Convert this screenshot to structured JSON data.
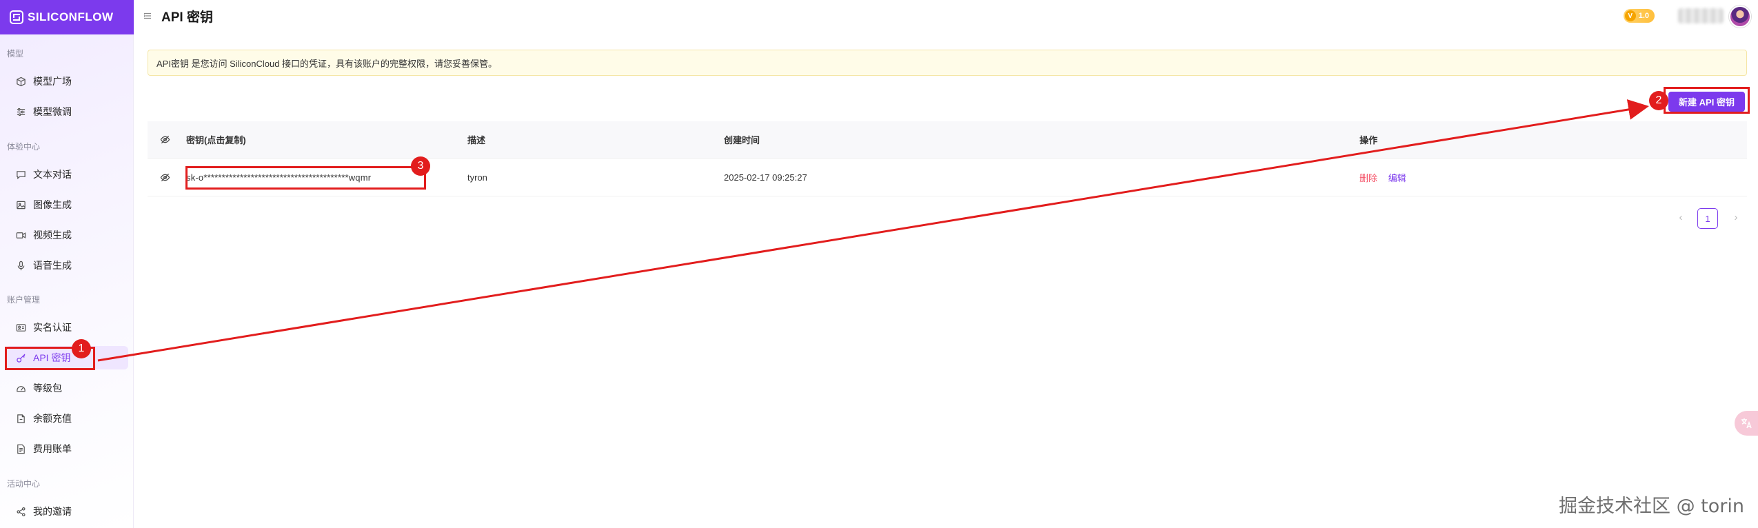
{
  "brand": {
    "name": "SILICONFLOW"
  },
  "sidebar": {
    "sections": [
      {
        "label": "模型",
        "items": [
          {
            "label": "模型广场",
            "icon": "cube-icon"
          },
          {
            "label": "模型微调",
            "icon": "sliders-icon"
          }
        ]
      },
      {
        "label": "体验中心",
        "items": [
          {
            "label": "文本对话",
            "icon": "chat-icon"
          },
          {
            "label": "图像生成",
            "icon": "image-icon"
          },
          {
            "label": "视频生成",
            "icon": "video-icon"
          },
          {
            "label": "语音生成",
            "icon": "mic-icon"
          }
        ]
      },
      {
        "label": "账户管理",
        "items": [
          {
            "label": "实名认证",
            "icon": "id-card-icon"
          },
          {
            "label": "API 密钥",
            "icon": "key-icon",
            "active": true
          },
          {
            "label": "等级包",
            "icon": "gauge-icon"
          },
          {
            "label": "余额充值",
            "icon": "wallet-icon"
          },
          {
            "label": "费用账单",
            "icon": "bill-icon"
          }
        ]
      },
      {
        "label": "活动中心",
        "items": [
          {
            "label": "我的邀请",
            "icon": "share-icon"
          }
        ]
      }
    ]
  },
  "header": {
    "title": "API 密钥",
    "level": "1.0"
  },
  "notice": "API密钥 是您访问 SiliconCloud 接口的凭证，具有该账户的完整权限，请您妥善保管。",
  "actions": {
    "new_key_label": "新建 API 密钥"
  },
  "table": {
    "columns": [
      "密钥(点击复制)",
      "描述",
      "创建时间",
      "操作"
    ],
    "rows": [
      {
        "key": "sk-o****************************************wqmr",
        "description": "tyron",
        "created": "2025-02-17 09:25:27",
        "ops": [
          "删除",
          "编辑"
        ]
      }
    ]
  },
  "pagination": {
    "current": "1",
    "prev": "‹",
    "next": "›"
  },
  "annotations": {
    "badges": [
      "1",
      "2",
      "3"
    ],
    "color": "#e21d1d"
  },
  "colors": {
    "accent": "#7c3aed",
    "danger": "#f5566b",
    "notice_bg": "#fffce8"
  },
  "watermark": "掘金技术社区 @ torin"
}
